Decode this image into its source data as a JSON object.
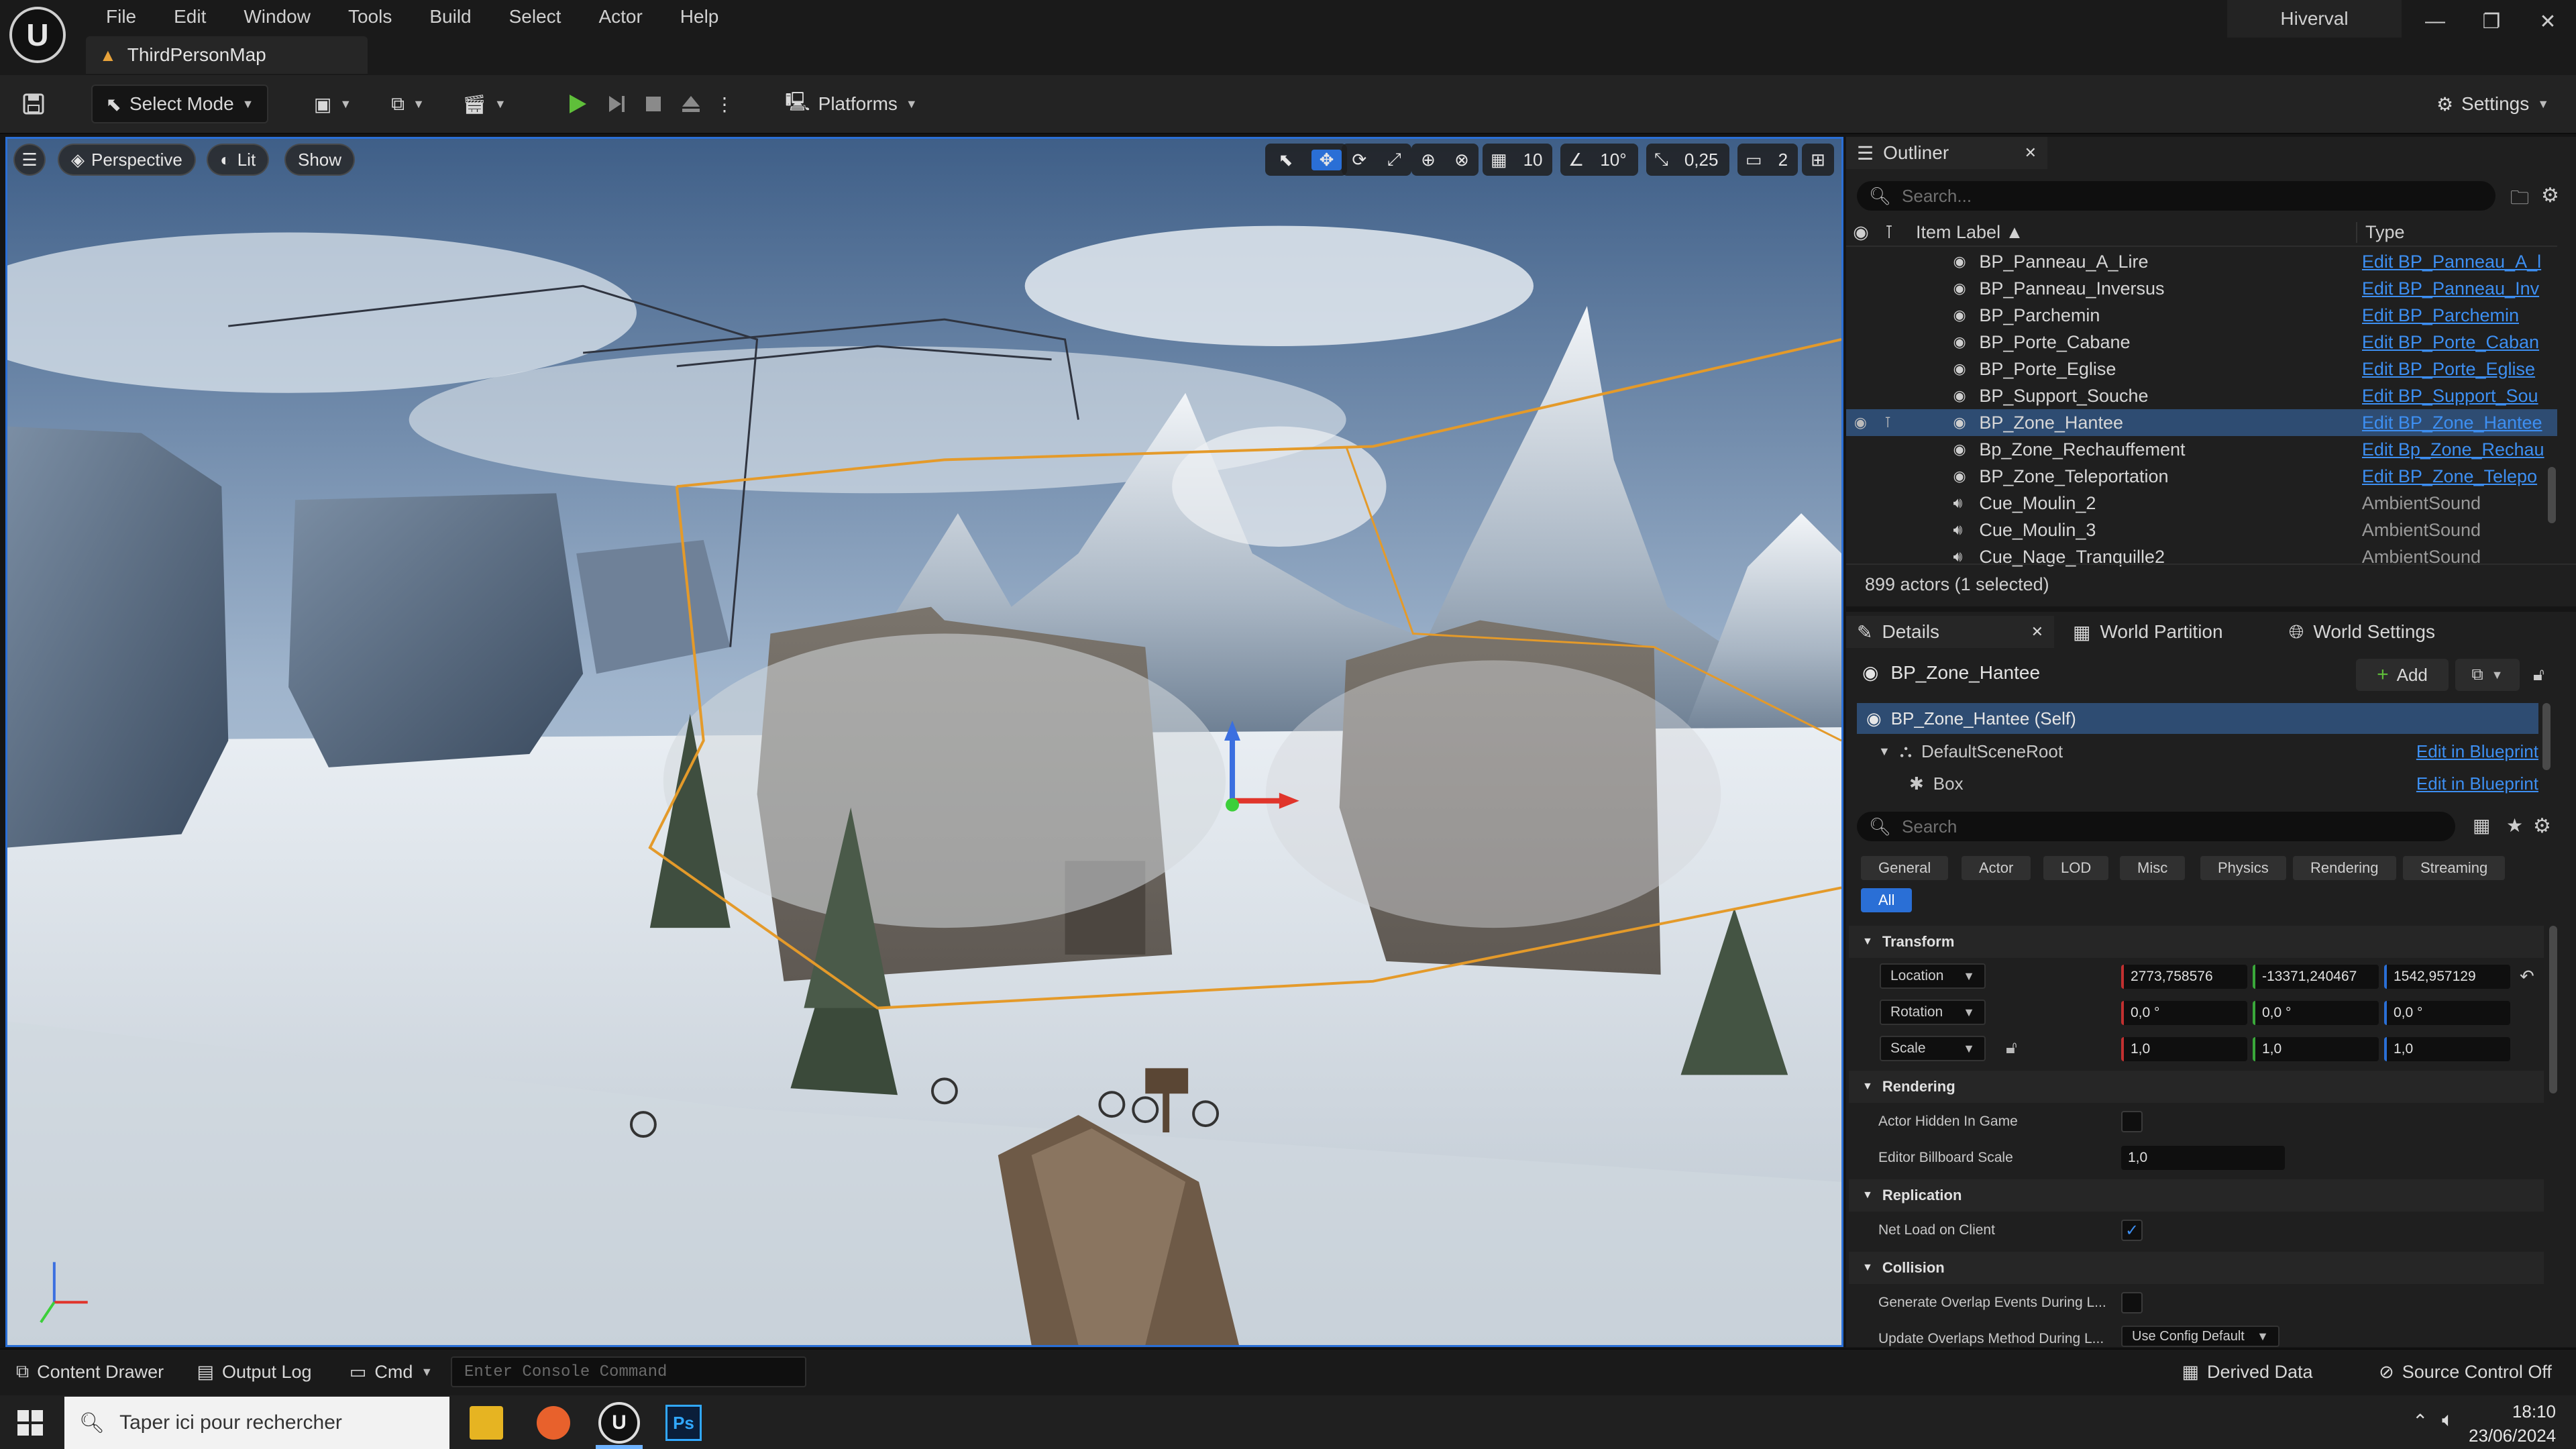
{
  "menu": {
    "items": [
      "File",
      "Edit",
      "Window",
      "Tools",
      "Build",
      "Select",
      "Actor",
      "Help"
    ],
    "project_name": "Hiverval",
    "map_tab": "ThirdPersonMap"
  },
  "toolbar": {
    "select_mode": "Select Mode",
    "platforms": "Platforms",
    "settings": "Settings"
  },
  "viewport": {
    "perspective": "Perspective",
    "lit": "Lit",
    "show": "Show",
    "grid_snap": "10",
    "rotation_snap": "10°",
    "scale_snap": "0,25",
    "camera_speed": "2"
  },
  "outliner": {
    "tab_label": "Outliner",
    "search_placeholder": "Search...",
    "col_label": "Item Label",
    "col_type": "Type",
    "rows": [
      {
        "label": "BP_Panneau_A_Lire",
        "type": "Edit BP_Panneau_A_l",
        "link": true
      },
      {
        "label": "BP_Panneau_Inversus",
        "type": "Edit BP_Panneau_Inv",
        "link": true
      },
      {
        "label": "BP_Parchemin",
        "type": "Edit BP_Parchemin",
        "link": true
      },
      {
        "label": "BP_Porte_Cabane",
        "type": "Edit BP_Porte_Caban",
        "link": true
      },
      {
        "label": "BP_Porte_Eglise",
        "type": "Edit BP_Porte_Eglise",
        "link": true
      },
      {
        "label": "BP_Support_Souche",
        "type": "Edit BP_Support_Sou",
        "link": true
      },
      {
        "label": "BP_Zone_Hantee",
        "type": "Edit BP_Zone_Hantee",
        "link": true,
        "selected": true
      },
      {
        "label": "Bp_Zone_Rechauffement",
        "type": "Edit Bp_Zone_Rechau",
        "link": true
      },
      {
        "label": "BP_Zone_Teleportation",
        "type": "Edit BP_Zone_Telepo",
        "link": true
      },
      {
        "label": "Cue_Moulin_2",
        "type": "AmbientSound",
        "link": false
      },
      {
        "label": "Cue_Moulin_3",
        "type": "AmbientSound",
        "link": false
      },
      {
        "label": "Cue_Nage_Tranquille2",
        "type": "AmbientSound",
        "link": false
      }
    ],
    "actor_count": "899 actors (1 selected)"
  },
  "details": {
    "tabs": [
      "Details",
      "World Partition",
      "World Settings"
    ],
    "actor_name": "BP_Zone_Hantee",
    "add_label": "Add",
    "components": {
      "self": "BP_Zone_Hantee (Self)",
      "root": "DefaultSceneRoot",
      "box": "Box",
      "edit_label": "Edit in Blueprint"
    },
    "search_placeholder": "Search",
    "categories": [
      "General",
      "Actor",
      "LOD",
      "Misc",
      "Physics",
      "Rendering",
      "Streaming"
    ],
    "category_all": "All",
    "transform": {
      "title": "Transform",
      "location_label": "Location",
      "location": [
        "2773,758576",
        "-13371,240467",
        "1542,957129"
      ],
      "rotation_label": "Rotation",
      "rotation": [
        "0,0 °",
        "0,0 °",
        "0,0 °"
      ],
      "scale_label": "Scale",
      "scale": [
        "1,0",
        "1,0",
        "1,0"
      ]
    },
    "rendering": {
      "title": "Rendering",
      "hidden_label": "Actor Hidden In Game",
      "billboard_label": "Editor Billboard Scale",
      "billboard_value": "1,0"
    },
    "replication": {
      "title": "Replication",
      "net_load_label": "Net Load on Client"
    },
    "collision": {
      "title": "Collision",
      "overlap_label": "Generate Overlap Events During L...",
      "update_label": "Update Overlaps Method During L...",
      "update_value": "Use Config Default"
    }
  },
  "statusbar": {
    "content_drawer": "Content Drawer",
    "output_log": "Output Log",
    "cmd": "Cmd",
    "console_placeholder": "Enter Console Command",
    "derived_data": "Derived Data",
    "source_control": "Source Control Off"
  },
  "taskbar": {
    "search_placeholder": "Taper ici pour rechercher",
    "time": "18:10",
    "date": "23/06/2024"
  },
  "colors": {
    "accent": "#2a6fd6",
    "link": "#3d8ff2",
    "selection": "#2e4c72",
    "play": "#5fbf3a"
  }
}
